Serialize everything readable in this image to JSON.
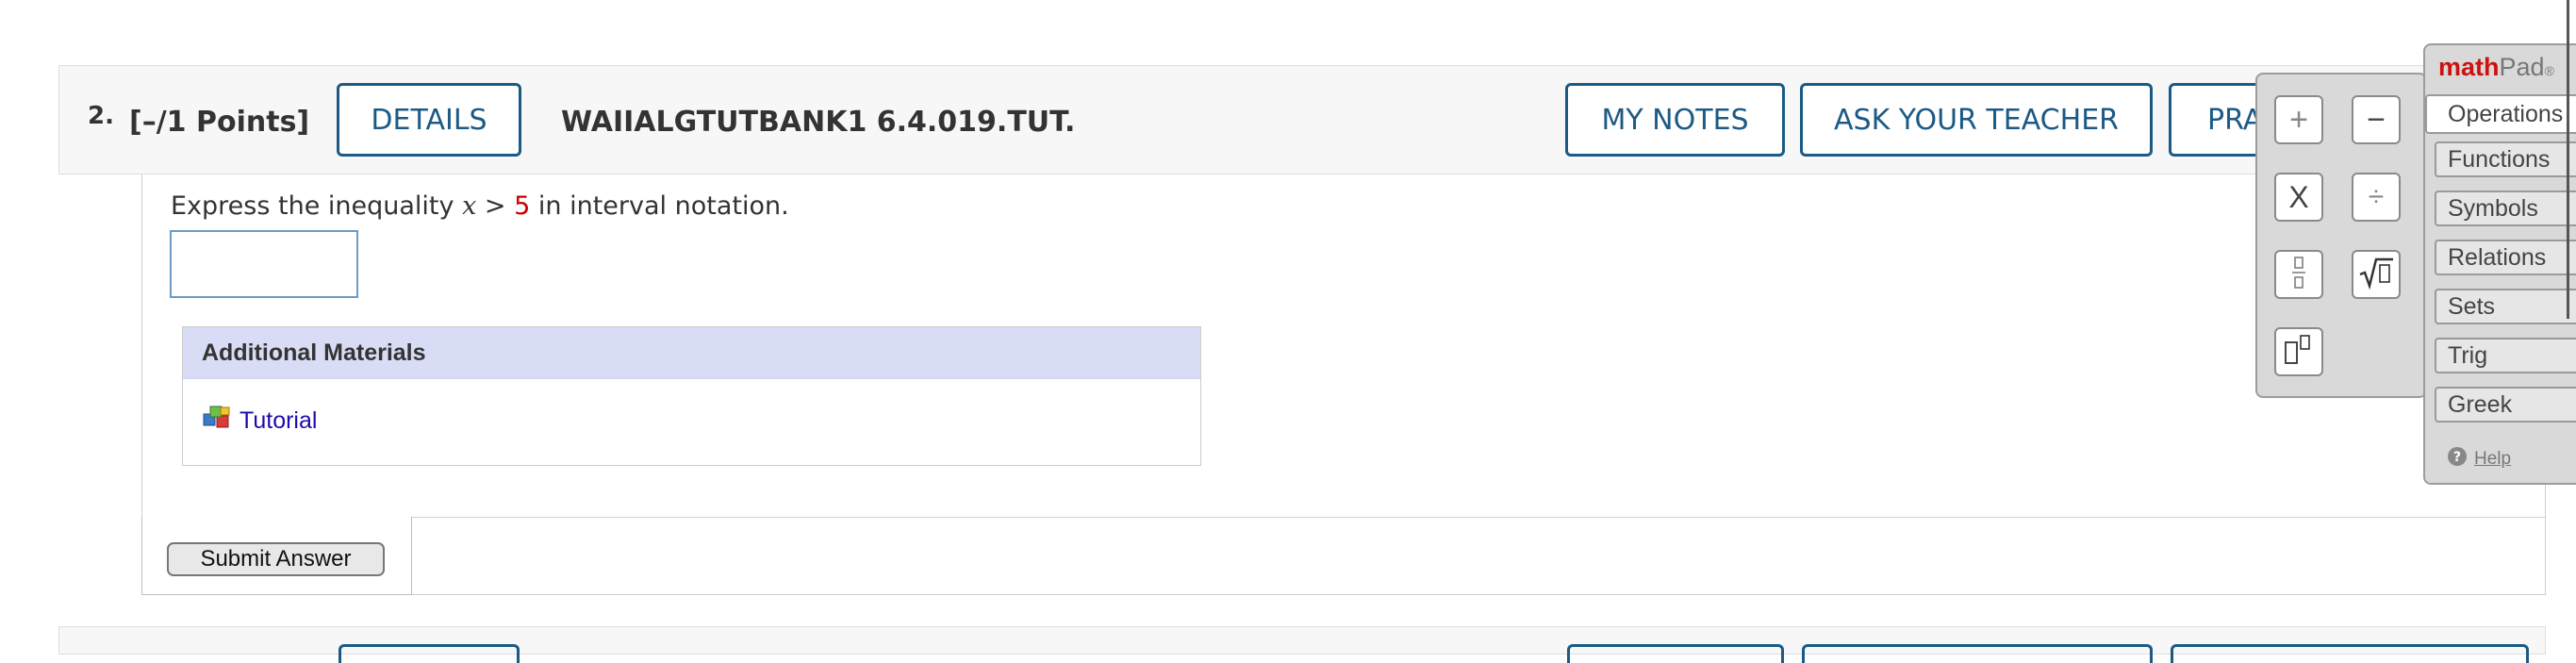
{
  "question": {
    "number": "2.",
    "points": "[–/1 Points]",
    "details_label": "DETAILS",
    "code": "WAIIALGTUTBANK1 6.4.019.TUT.",
    "my_notes_label": "MY NOTES",
    "ask_teacher_label": "ASK YOUR TEACHER",
    "practice_label": "PRA",
    "prompt_before": "Express the inequality ",
    "prompt_var": "x",
    "prompt_op": " > ",
    "prompt_num": "5",
    "prompt_after": " in interval notation.",
    "answer_value": ""
  },
  "materials": {
    "heading": "Additional Materials",
    "tutorial_label": "Tutorial",
    "tutorial_icon": "tutorial-cubes-icon"
  },
  "submit": {
    "label": "Submit Answer"
  },
  "mathpad": {
    "brand_math": "math",
    "brand_pad": "Pad",
    "brand_mark": "®",
    "keys": {
      "plus": "+",
      "minus": "−",
      "times": "X",
      "divide": "÷",
      "fraction": "fraction-icon",
      "sqrt": "sqrt-icon",
      "exponent": "exponent-icon"
    },
    "menu": {
      "operations": "Operations",
      "functions": "Functions",
      "symbols": "Symbols",
      "relations": "Relations",
      "sets": "Sets",
      "trig": "Trig",
      "greek": "Greek"
    },
    "help_label": "Help",
    "help_icon": "question-icon"
  },
  "colors": {
    "accent": "#1c5a85",
    "materials_header": "#d8dcf4",
    "link": "#1a0dab",
    "highlight_number": "#cc0000",
    "mathpad_brand": "#cc1111"
  }
}
